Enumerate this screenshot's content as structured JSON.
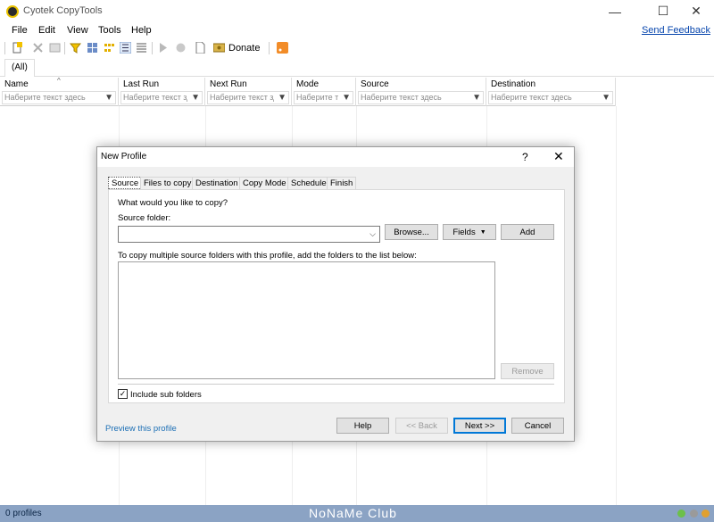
{
  "window": {
    "title": "Cyotek CopyTools",
    "controls": {
      "minimize": "—",
      "maximize": "☐",
      "close": "✕"
    }
  },
  "menu": {
    "items": [
      "File",
      "Edit",
      "View",
      "Tools",
      "Help"
    ],
    "feedback": "Send Feedback"
  },
  "toolbar": {
    "donate_label": "Donate",
    "icons": [
      "new-profile-icon",
      "delete-icon",
      "properties-icon",
      "filter-icon",
      "large-icons-icon",
      "small-icons-icon",
      "list-view-icon",
      "details-view-icon",
      "run-icon",
      "stop-icon",
      "page-icon",
      "donate-icon",
      "feed-icon"
    ]
  },
  "tabs": {
    "all": "(All)"
  },
  "grid": {
    "columns": [
      {
        "title": "Name",
        "filter_placeholder": "Наберите текст здесь"
      },
      {
        "title": "Last Run",
        "filter_placeholder": "Наберите текст здесь"
      },
      {
        "title": "Next Run",
        "filter_placeholder": "Наберите текст здесь"
      },
      {
        "title": "Mode",
        "filter_placeholder": "Наберите текст здесь"
      },
      {
        "title": "Source",
        "filter_placeholder": "Наберите текст здесь"
      },
      {
        "title": "Destination",
        "filter_placeholder": "Наберите текст здесь"
      }
    ],
    "sort_indicator": "^"
  },
  "dialog": {
    "title": "New Profile",
    "help": "?",
    "close": "✕",
    "tabs": [
      "Source",
      "Files to copy",
      "Destination",
      "Copy Mode",
      "Schedule",
      "Finish"
    ],
    "active_tab": "Source",
    "question": "What would you like to copy?",
    "source_folder_label": "Source folder:",
    "source_folder_value": "",
    "browse_button": "Browse...",
    "fields_button": "Fields",
    "add_button": "Add",
    "multi_hint": "To copy multiple source folders with this profile, add the folders to the list below:",
    "remove_button": "Remove",
    "include_sub_folders": "Include sub folders",
    "include_sub_folders_checked": true,
    "preview_link": "Preview this profile",
    "help_button": "Help",
    "back_button": "<< Back",
    "next_button": "Next >>",
    "cancel_button": "Cancel"
  },
  "status": {
    "profiles": "0 profiles",
    "watermark": "NoNaMe Club",
    "dot_colors": [
      "#6cc04a",
      "#9a9a9a",
      "#e0a030"
    ]
  }
}
